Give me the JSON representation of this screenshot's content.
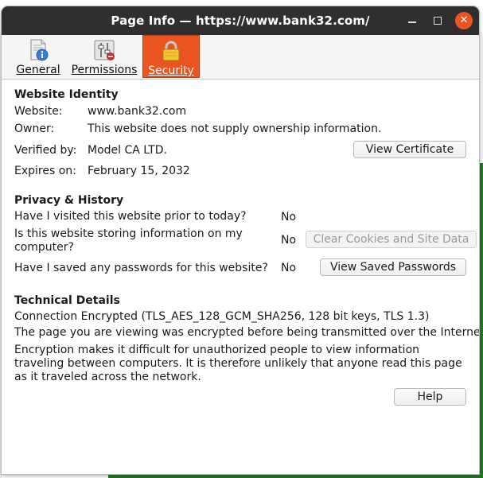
{
  "window": {
    "title": "Page Info — https://www.bank32.com/"
  },
  "titlebar": {
    "minimize_icon": "minimize-icon",
    "maximize_icon": "maximize-icon",
    "close_icon": "close-icon",
    "close_glyph": "✕"
  },
  "tabs": [
    {
      "label": "General",
      "icon": "info-document-icon",
      "selected": false
    },
    {
      "label": "Permissions",
      "icon": "permissions-sliders-icon",
      "selected": false
    },
    {
      "label": "Security",
      "icon": "padlock-icon",
      "selected": true
    }
  ],
  "identity": {
    "heading": "Website Identity",
    "website_label": "Website:",
    "website_value": "www.bank32.com",
    "owner_label": "Owner:",
    "owner_value": "This website does not supply ownership information.",
    "verified_label": "Verified by:",
    "verified_value": "Model CA LTD.",
    "expires_label": "Expires on:",
    "expires_value": "February 15, 2032",
    "view_certificate": "View Certificate"
  },
  "privacy": {
    "heading": "Privacy & History",
    "q1": "Have I visited this website prior to today?",
    "a1": "No",
    "q2": "Is this website storing information on my computer?",
    "a2": "No",
    "clear_cookies": "Clear Cookies and Site Data",
    "q3": "Have I saved any passwords for this website?",
    "a3": "No",
    "view_passwords": "View Saved Passwords"
  },
  "technical": {
    "heading": "Technical Details",
    "connection": "Connection Encrypted (TLS_AES_128_GCM_SHA256, 128 bit keys, TLS 1.3)",
    "line1": "The page you are viewing was encrypted before being transmitted over the Internet.",
    "line2": "Encryption makes it difficult for unauthorized people to view information traveling between computers. It is therefore unlikely that anyone read this page as it traveled across the network."
  },
  "help": {
    "label": "Help"
  },
  "colors": {
    "accent": "#e95420",
    "titlebar": "#2f2f2f"
  }
}
